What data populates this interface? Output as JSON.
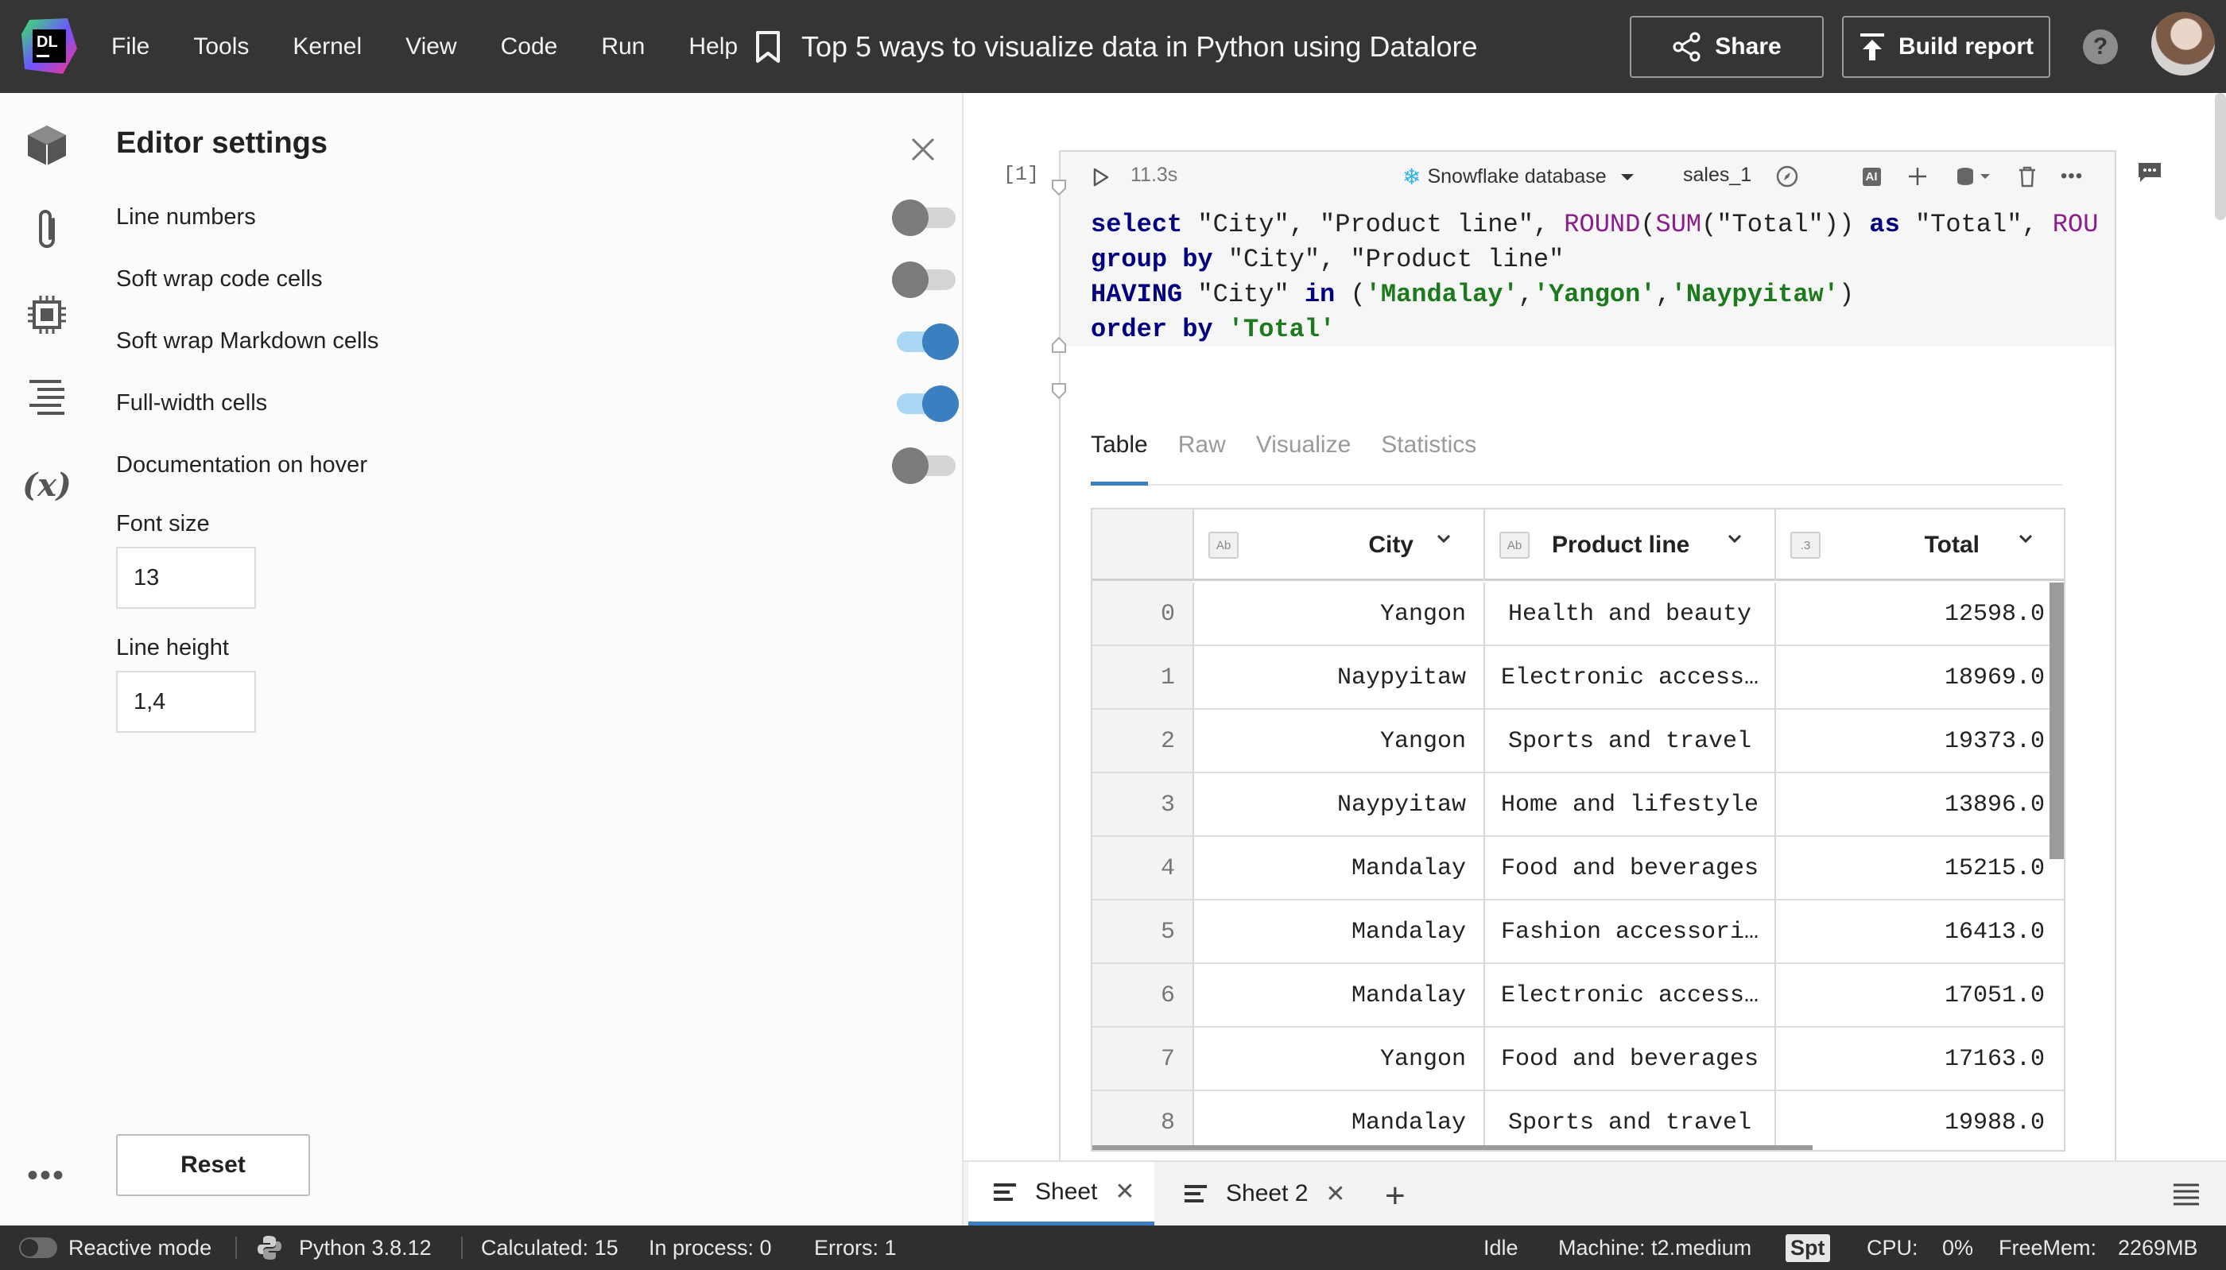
{
  "topbar": {
    "logo_text": "DL",
    "menu": [
      "File",
      "Tools",
      "Kernel",
      "View",
      "Code",
      "Run",
      "Help"
    ],
    "doc_title": "Top 5 ways to visualize data in Python using Datalore",
    "share_label": "Share",
    "report_label": "Build report",
    "help_label": "?"
  },
  "panel": {
    "title": "Editor settings",
    "settings": [
      {
        "label": "Line numbers",
        "on": false
      },
      {
        "label": "Soft wrap code cells",
        "on": false
      },
      {
        "label": "Soft wrap Markdown cells",
        "on": true
      },
      {
        "label": "Full-width cells",
        "on": true
      },
      {
        "label": "Documentation on hover",
        "on": false
      }
    ],
    "font_size_label": "Font size",
    "font_size_value": "13",
    "line_height_label": "Line height",
    "line_height_value": "1,4",
    "reset_label": "Reset"
  },
  "cell": {
    "index": "[1]",
    "time": "11.3s",
    "database": "Snowflake database",
    "variable": "sales_1",
    "ai_label": "AI"
  },
  "output": {
    "tabs": [
      "Table",
      "Raw",
      "Visualize",
      "Statistics"
    ],
    "active_tab": "Table",
    "columns": [
      {
        "type": "Ab",
        "name": "City"
      },
      {
        "type": "Ab",
        "name": "Product line"
      },
      {
        "type": ".3",
        "name": "Total"
      }
    ],
    "rows": [
      {
        "i": "0",
        "city": "Yangon",
        "product": "Health and beauty",
        "total": "12598.0"
      },
      {
        "i": "1",
        "city": "Naypyitaw",
        "product": "Electronic access…",
        "total": "18969.0"
      },
      {
        "i": "2",
        "city": "Yangon",
        "product": "Sports and travel",
        "total": "19373.0"
      },
      {
        "i": "3",
        "city": "Naypyitaw",
        "product": "Home and lifestyle",
        "total": "13896.0"
      },
      {
        "i": "4",
        "city": "Mandalay",
        "product": "Food and beverages",
        "total": "15215.0"
      },
      {
        "i": "5",
        "city": "Mandalay",
        "product": "Fashion accessori…",
        "total": "16413.0"
      },
      {
        "i": "6",
        "city": "Mandalay",
        "product": "Electronic access…",
        "total": "17051.0"
      },
      {
        "i": "7",
        "city": "Yangon",
        "product": "Food and beverages",
        "total": "17163.0"
      },
      {
        "i": "8",
        "city": "Mandalay",
        "product": "Sports and travel",
        "total": "19988.0"
      }
    ]
  },
  "sheets": {
    "tabs": [
      "Sheet",
      "Sheet 2"
    ],
    "close_glyph": "✕",
    "add_glyph": "+"
  },
  "status": {
    "reactive": "Reactive mode",
    "python": "Python 3.8.12",
    "calculated": "Calculated: 15",
    "in_process": "In process: 0",
    "errors": "Errors: 1",
    "state": "Idle",
    "machine": "Machine: t2.medium",
    "spt": "Spt",
    "cpu_label": "CPU:",
    "cpu_value": "0%",
    "freemem_label": "FreeMem:",
    "freemem_value": "2269MB"
  },
  "colors": {
    "accent": "#3a7fc0",
    "topbar": "#353535",
    "statusbar": "#2f2f2f"
  }
}
